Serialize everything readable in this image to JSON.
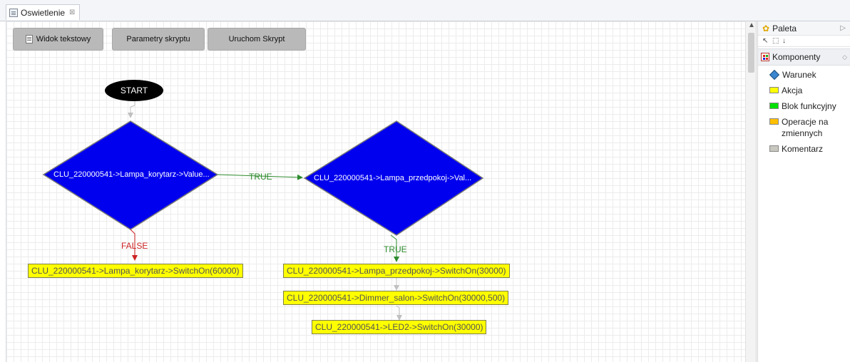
{
  "tab": {
    "title": "Oswietlenie",
    "close": "⊠"
  },
  "toolbar": {
    "text_view": "Widok tekstowy",
    "script_params": "Parametry skryptu",
    "run_script": "Uruchom Skrypt"
  },
  "flow": {
    "start": "START",
    "condition1": "CLU_220000541->Lampa_korytarz->Value...",
    "condition2": "CLU_220000541->Lampa_przedpokoj->Val...",
    "true_label_1": "TRUE",
    "true_label_2": "TRUE",
    "false_label": "FALSE",
    "action_false": "CLU_220000541->Lampa_korytarz->SwitchOn(60000)",
    "action1": "CLU_220000541->Lampa_przedpokoj->SwitchOn(30000)",
    "action2": "CLU_220000541->Dimmer_salon->SwitchOn(30000,500)",
    "action3": "CLU_220000541->LED2->SwitchOn(30000)"
  },
  "palette": {
    "title": "Paleta",
    "drawer": "Komponenty",
    "items": [
      {
        "label": "Warunek",
        "icon": "diamond-icon"
      },
      {
        "label": "Akcja",
        "color": "#ffff00"
      },
      {
        "label": "Blok funkcyjny",
        "color": "#00e000"
      },
      {
        "label": "Operacje na zmiennych",
        "color": "#ffc000"
      },
      {
        "label": "Komentarz",
        "color": "#c8c8c0"
      }
    ]
  },
  "colors": {
    "condition_fill": "#0000ee",
    "action_fill": "#ffff00",
    "true_edge": "#2e8b2e",
    "false_edge": "#cc2222"
  }
}
